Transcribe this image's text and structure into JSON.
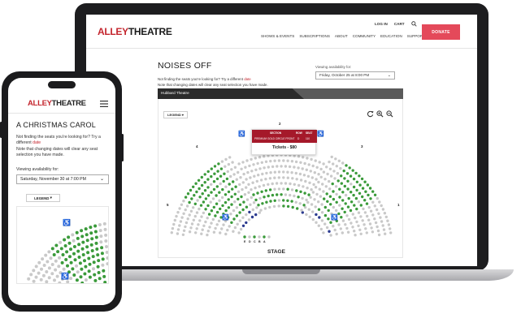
{
  "laptop": {
    "logo": {
      "alley": "ALLEY",
      "theatre": "THEATRE"
    },
    "utility_nav": [
      "LOG IN",
      "CART"
    ],
    "main_nav": [
      "SHOWS & EVENTS",
      "SUBSCRIPTIONS",
      "ABOUT",
      "COMMUNITY",
      "EDUCATION",
      "SUPPORT"
    ],
    "donate_label": "DONATE",
    "show_title": "NOISES OFF",
    "notice_line1_text": "Not finding the seats you're looking for? Try a different ",
    "notice_line1_link": "date",
    "notice_line2": "Note that changing dates will clear any seat selection you have made.",
    "availability_label": "Viewing availability for:",
    "selected_date": "Friday, October 25 at 8:00 PM",
    "venue": "Hubbard Theatre",
    "legend_label": "LEGEND",
    "tooltip": {
      "section_header": "SECTION",
      "row_header": "ROW",
      "seat_header": "SEAT",
      "section": "PREMIUM GOLD CIRCLE FRONT",
      "row": "D",
      "seat": "110",
      "price": "Tickets - $80"
    },
    "section_numbers": [
      "2",
      "3",
      "4",
      "5",
      "1"
    ],
    "front_row_letters": [
      "E",
      "D",
      "C",
      "B",
      "A"
    ],
    "stage_label": "STAGE"
  },
  "phone": {
    "logo": {
      "alley": "ALLEY",
      "theatre": "THEATRE"
    },
    "show_title": "A CHRISTMAS CAROL",
    "notice_line1_text": "Not finding the seats you're looking for? Try a different ",
    "notice_line1_link": "date",
    "notice_line2": "Note that changing dates will clear any seat selection you have made.",
    "availability_label": "Viewing availability for:",
    "selected_date": "Saturday, November 30 at 7:00 PM",
    "legend_label": "LEGEND"
  },
  "colors": {
    "brand_red": "#c4262e",
    "donate_pink": "#e4495a",
    "tooltip_red": "#a5192a",
    "seat_available": "#3a9a3a",
    "seat_unavailable": "#c9c9c9",
    "seat_accessible": "#2b3a8f",
    "device_frame": "#1d1d1f"
  },
  "icons": [
    "search-icon",
    "refresh-icon",
    "zoom-in-icon",
    "zoom-out-icon",
    "wheelchair-icon",
    "hamburger-menu-icon",
    "chevron-down-icon"
  ]
}
